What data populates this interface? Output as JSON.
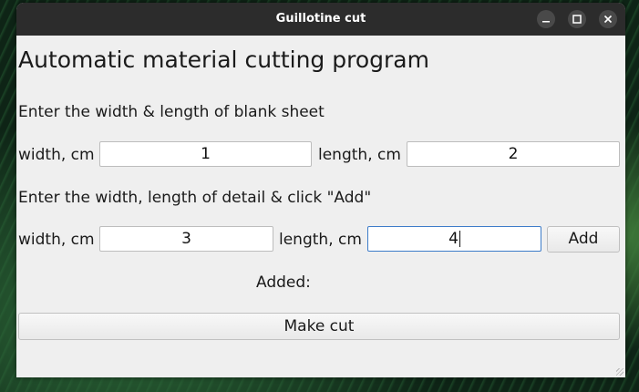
{
  "window": {
    "title": "Guillotine cut",
    "controls": {
      "minimize": "–",
      "maximize": "□",
      "close": "✕"
    }
  },
  "main": {
    "heading": "Automatic material cutting program",
    "sheet_prompt": "Enter the width & length of blank sheet",
    "sheet": {
      "width_label": "width, cm",
      "width_value": "1",
      "length_label": "length, cm",
      "length_value": "2"
    },
    "detail_prompt": "Enter the width, length of detail & click \"Add\"",
    "detail": {
      "width_label": "width, cm",
      "width_value": "3",
      "length_label": "length, cm",
      "length_value": "4",
      "add_label": "Add"
    },
    "added_label": "Added:",
    "make_cut_label": "Make cut"
  }
}
